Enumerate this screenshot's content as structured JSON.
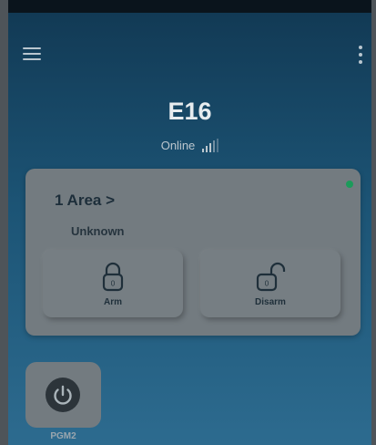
{
  "header": {
    "menu_icon": "hamburger-icon",
    "more_icon": "more-vert-icon"
  },
  "device": {
    "name": "E16",
    "status": "Online",
    "signal_icon": "signal-bars-icon"
  },
  "area": {
    "title": "1 Area >",
    "state": "Unknown",
    "indicator_color": "#1b9b5a",
    "actions": [
      {
        "label": "Arm",
        "icon": "lock-closed-icon",
        "badge": "0"
      },
      {
        "label": "Disarm",
        "icon": "lock-open-icon",
        "badge": "0"
      }
    ]
  },
  "outputs": [
    {
      "label": "PGM2",
      "icon": "power-icon"
    }
  ]
}
